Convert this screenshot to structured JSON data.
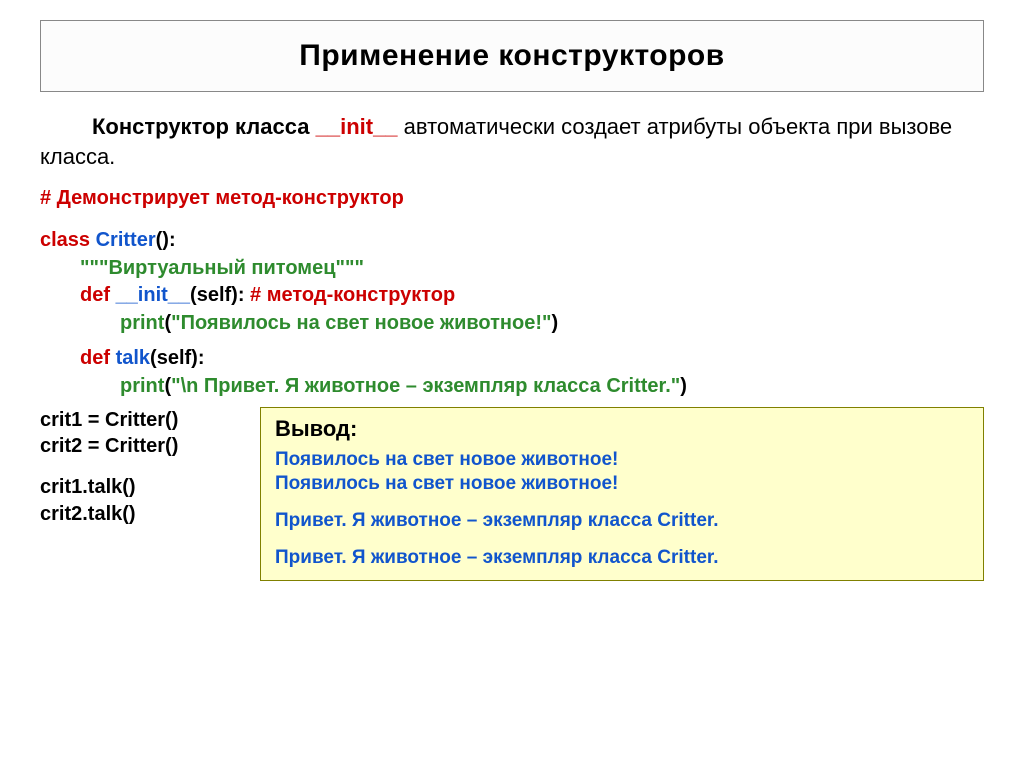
{
  "title": "Применение конструкторов",
  "intro": {
    "part1": "Конструктор класса ",
    "init": "__init__",
    "part2": " автоматически создает атрибуты объекта при вызове класса."
  },
  "code": {
    "comment_demo": "# Демонстрирует метод-конструктор",
    "class_kw": "class ",
    "class_name": "Critter",
    "class_tail": "():",
    "docstring": "\"\"\"Виртуальный питомец\"\"\"",
    "def_kw": "def ",
    "init_name": "__init__",
    "init_args": "(self):",
    "init_comment": "   # метод-конструктор",
    "print_fn": "print",
    "init_print_open": "(",
    "init_print_str": "\"Появилось на свет новое животное!\"",
    "init_print_close": ")",
    "talk_name": "talk",
    "talk_args": "(self):",
    "talk_print_str": "\"\\n Привет.  Я животное – экземпляр класса Critter.\"",
    "crit1": "crit1 = Critter()",
    "crit2": "crit2 = Critter()",
    "call1": "crit1.talk()",
    "call2": "crit2.talk()"
  },
  "output": {
    "title": "Вывод:",
    "line1": "Появилось на свет новое животное!",
    "line2": "Появилось на свет новое животное!",
    "line3": "Привет.  Я животное – экземпляр класса Critter.",
    "line4": "Привет.  Я животное – экземпляр класса Critter."
  }
}
